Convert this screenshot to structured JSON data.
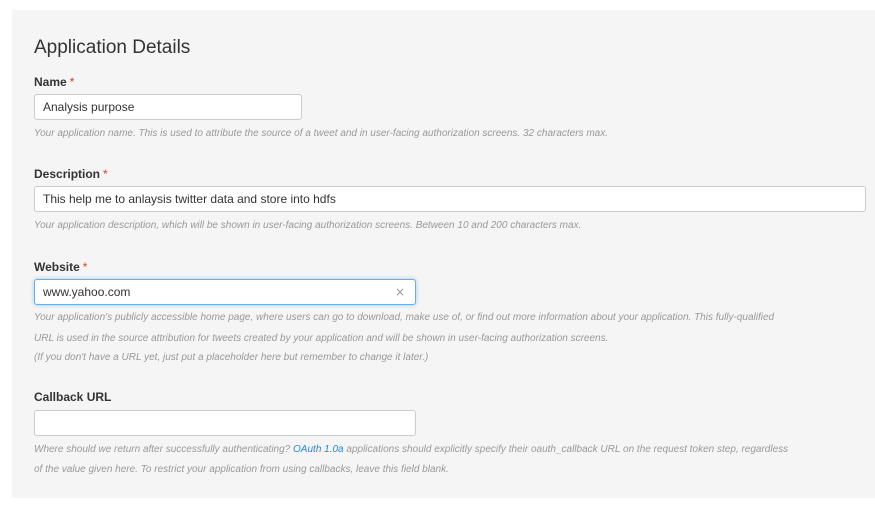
{
  "section": {
    "title": "Application Details"
  },
  "fields": {
    "name": {
      "label": "Name",
      "required_marker": "*",
      "value": "Analysis purpose",
      "help": "Your application name. This is used to attribute the source of a tweet and in user-facing authorization screens. 32 characters max."
    },
    "description": {
      "label": "Description",
      "required_marker": "*",
      "value": "This help me to anlaysis twitter data and store into hdfs",
      "help": "Your application description, which will be shown in user-facing authorization screens. Between 10 and 200 characters max."
    },
    "website": {
      "label": "Website",
      "required_marker": "*",
      "value": "www.yahoo.com",
      "clear_glyph": "×",
      "help_line1": "Your application's publicly accessible home page, where users can go to download, make use of, or find out more information about your application. This fully-qualified",
      "help_line2": "URL is used in the source attribution for tweets created by your application and will be shown in user-facing authorization screens.",
      "help_line3": "(If you don't have a URL yet, just put a placeholder here but remember to change it later.)"
    },
    "callback": {
      "label": "Callback URL",
      "value": "",
      "help_before_link": "Where should we return after successfully authenticating? ",
      "help_link": "OAuth 1.0a",
      "help_after_link": " applications should explicitly specify their oauth_callback URL on the request token step, regardless",
      "help_line2": "of the value given here. To restrict your application from using callbacks, leave this field blank."
    }
  },
  "colors": {
    "panel_bg": "#f5f5f5",
    "required": "#e0392b",
    "link": "#1a8cd8",
    "help_text": "#999999",
    "focus_border": "#66afe9"
  }
}
